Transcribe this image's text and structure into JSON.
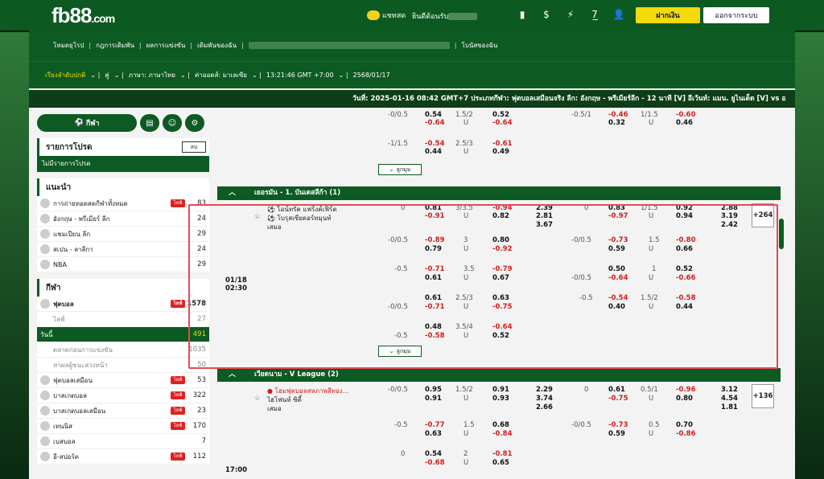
{
  "brand": {
    "logo_main": "fb88",
    "logo_suffix": ".com"
  },
  "topbar": {
    "chat_label": "แชทสด",
    "welcome_label": "ยินดีต้อนรับ",
    "icons": [
      "card-icon",
      "dollar-icon",
      "refresh-icon",
      "777-icon",
      "user-icon",
      "list-icon"
    ],
    "icon_glyphs": [
      "▮",
      "$",
      "⚡",
      "7̲",
      "👤",
      "☰"
    ],
    "deposit_label": "ฝากเงิน",
    "logout_label": "ออกจากระบบ"
  },
  "nav1": {
    "items": [
      "โหมดยุโรป",
      "กฎการเดิมพัน",
      "ผลการแข่งขัน",
      "เดิมพันของฉัน",
      "โบนัสของฉัน"
    ]
  },
  "nav2": {
    "sort_label": "เรียงลำดับปกติ",
    "odds_type": "คู่",
    "language": "ภาษา: ภาษาไทย",
    "odds_format": "ค่าออดส์: มาเลเซีย",
    "time": "13:21:46 GMT +7:00",
    "date": "2568/01/17"
  },
  "ticker": {
    "text": "วันที่: 2025-01-16 08:42 GMT+7 ประเภทกีฬา: ฟุตบอลเสมือนจริง ลีก: อังกฤษ - พรีเมียร์ลีก - 12 นาที [V] อีเว้นท์: แมน. ยูไนเต็ด [V] vs อ"
  },
  "sidebar": {
    "sport_btn": "กีฬา",
    "fav_title": "รายการโปรด",
    "fav_delete": "ลบ",
    "fav_empty": "ไม่มีรายการโปรด",
    "rec_title": "แนะนำ",
    "recommended": [
      {
        "label": "การถ่ายทอดสดกีฬาทั้งหมด",
        "count": "83",
        "live": true
      },
      {
        "label": "อังกฤษ - พรีเมียร์ ลีก",
        "count": "24"
      },
      {
        "label": "แชมเปียน ลีก",
        "count": "29"
      },
      {
        "label": "สเปน - ลาลีกา",
        "count": "24"
      },
      {
        "label": "NBA",
        "count": "29"
      }
    ],
    "sports_title": "กีฬา",
    "sports": [
      {
        "label": "ฟุตบอล",
        "count": "1578",
        "live": true,
        "type": "head"
      },
      {
        "label": "ไลฟ์",
        "count": "27",
        "type": "sub"
      },
      {
        "label": "วันนี้",
        "count": "491",
        "type": "active"
      },
      {
        "label": "ตลาดก่อนการแข่งขัน",
        "count": "1035",
        "type": "sub"
      },
      {
        "label": "หาผลผู้ชนะล่วงหน้า",
        "count": "50",
        "type": "sub"
      },
      {
        "label": "ฟุตบอลเสมือน",
        "count": "53",
        "live": true
      },
      {
        "label": "บาสเกตบอล",
        "count": "322",
        "live": true
      },
      {
        "label": "บาสเกตบอลเสมือน",
        "count": "23",
        "live": true
      },
      {
        "label": "เทนนิส",
        "count": "170",
        "live": true
      },
      {
        "label": "เบสบอล",
        "count": "7"
      },
      {
        "label": "อี-สปอร์ต",
        "count": "112",
        "live": true
      }
    ],
    "live_badge": "ไลฟ์"
  },
  "main": {
    "expand_label": "ลูกมุม",
    "league1": "เยอรมัน - 1. บันเดสลีก้า (1)",
    "league2": "เวียดนาม - V League (2)",
    "match1_time": "01/18",
    "match1_hour": "02:30",
    "match1_home": "ไอน์ทรัค แฟร้งค์เฟิร์ต",
    "match1_away": "โบรุสเซียดอร์ทมุนท์",
    "match1_draw": "เสมอ",
    "match1_plus": "+264",
    "match2_hour": "17:00",
    "match2_home": "โฮมฟุตบอลสหภาพสีทอง...",
    "match2_away": "ไฮโฟนท์ ซิตี้",
    "match2_draw": "เสมอ",
    "match2_plus": "+136"
  }
}
